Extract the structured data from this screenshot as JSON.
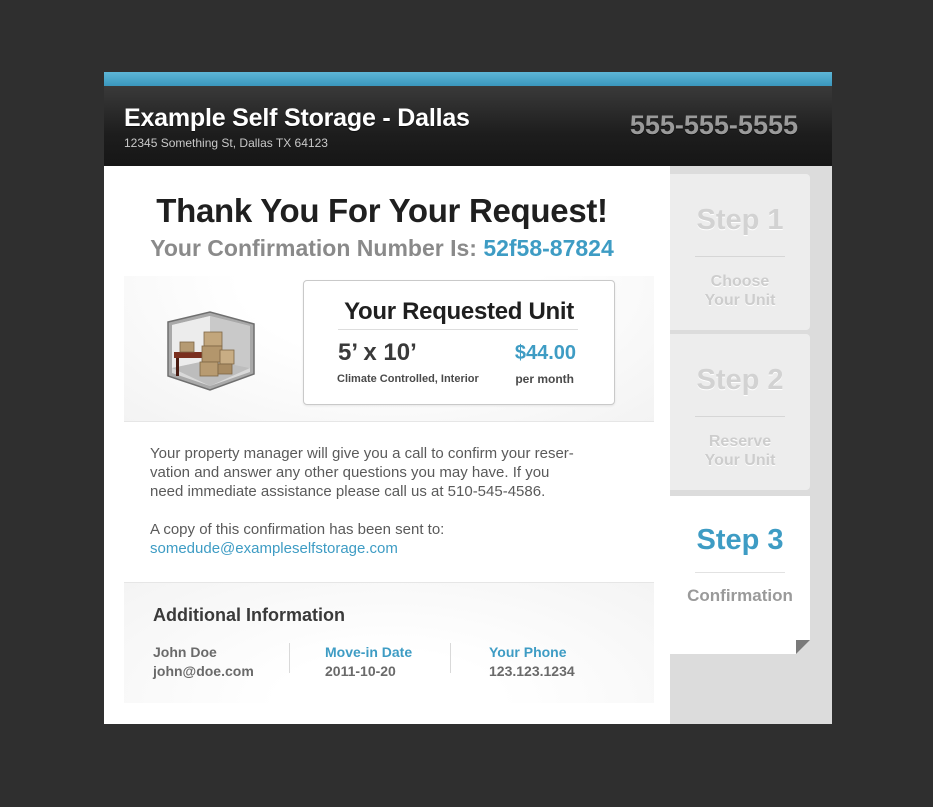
{
  "header": {
    "title": "Example Self Storage - Dallas",
    "address": "12345 Something St, Dallas TX 64123",
    "phone": "555-555-5555"
  },
  "steps": [
    {
      "title": "Step 1",
      "label_line1": "Choose",
      "label_line2": "Your Unit",
      "active": false
    },
    {
      "title": "Step 2",
      "label_line1": "Reserve",
      "label_line2": "Your Unit",
      "active": false
    },
    {
      "title": "Step 3",
      "label_line1": "Confirmation",
      "label_line2": "",
      "active": true
    }
  ],
  "confirmation": {
    "heading": "Thank You For Your Request!",
    "number_label": "Your Confirmation Number Is:",
    "number": "52f58-87824"
  },
  "unit": {
    "title": "Your Requested Unit",
    "size": "5’ x 10’",
    "description": "Climate Controlled, Interior",
    "price": "$44.00",
    "price_period": "per month",
    "illustration_icon": "storage-unit-boxes-icon"
  },
  "message": {
    "line1": "Your property manager will give you a call to confirm your reser-",
    "line2": "vation and answer any other questions you may have. If you",
    "line3": "need immediate assistance please call us at 510-545-4586.",
    "copy_label": "A copy of this confirmation has been sent to:",
    "copy_email": "somedude@exampleselfstorage.com"
  },
  "additional": {
    "title": "Additional Information",
    "name": "John Doe",
    "email": "john@doe.com",
    "move_in_label": "Move-in Date",
    "move_in_value": "2011-10-20",
    "phone_label": "Your Phone",
    "phone_value": "123.123.1234"
  },
  "colors": {
    "accent": "#3e9cc4",
    "background": "#2f2f2f",
    "header": "#1d1d1d"
  }
}
